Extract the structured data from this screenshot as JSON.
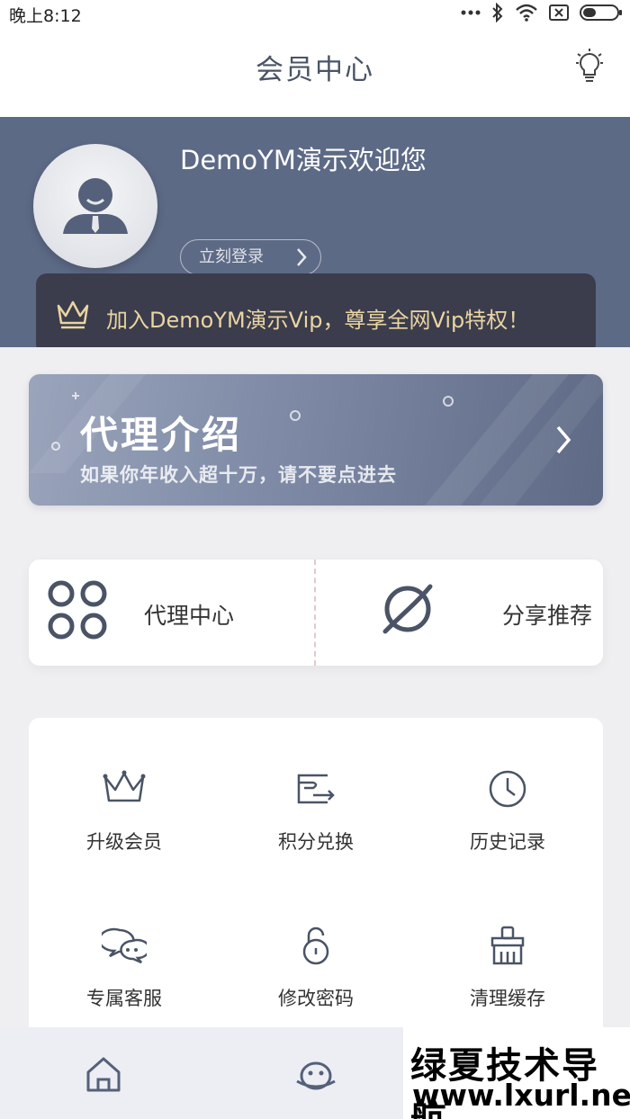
{
  "status_bar": {
    "time": "晚上8:12",
    "icons": [
      "more-dots-icon",
      "bluetooth-icon",
      "wifi-icon",
      "sim-none-icon",
      "battery-icon"
    ]
  },
  "header": {
    "title": "会员中心",
    "right_icon": "lightbulb-icon"
  },
  "profile": {
    "welcome_text": "DemoYM演示欢迎您",
    "login_label": "立刻登录",
    "vip_text": "加入DemoYM演示Vip，尊享全网Vip特权！"
  },
  "agent_banner": {
    "title": "代理介绍",
    "subtitle": "如果你年收入超十万，请不要点进去"
  },
  "quick_actions": [
    {
      "label": "代理中心",
      "icon": "agent-grid-icon"
    },
    {
      "label": "分享推荐",
      "icon": "planet-icon"
    }
  ],
  "menu_grid": [
    {
      "label": "升级会员",
      "icon": "crown-icon"
    },
    {
      "label": "积分兑换",
      "icon": "exchange-card-icon"
    },
    {
      "label": "历史记录",
      "icon": "clock-icon"
    },
    {
      "label": "专属客服",
      "icon": "chat-bubbles-icon"
    },
    {
      "label": "修改密码",
      "icon": "lock-icon"
    },
    {
      "label": "清理缓存",
      "icon": "broom-icon"
    }
  ],
  "bottom_nav": [
    {
      "icon": "home-icon"
    },
    {
      "icon": "alien-planet-icon"
    }
  ],
  "watermark": {
    "line1": "绿夏技术导航",
    "line2": "www.lxurl.net"
  },
  "colors": {
    "header_band": "#5d6a86",
    "vip_bar": "#3b3d4c",
    "vip_text": "#ead4a2",
    "icon_stroke": "#4a5466",
    "page_bg": "#efeff1"
  }
}
